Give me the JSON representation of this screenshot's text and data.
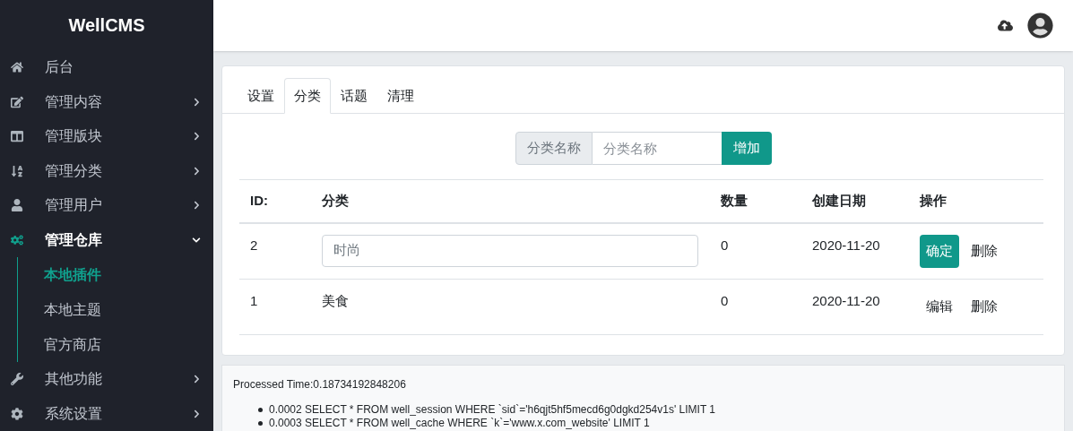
{
  "sidebar": {
    "logo": "WellCMS",
    "items": [
      {
        "label": "后台",
        "expanded": false
      },
      {
        "label": "管理内容",
        "expanded": false
      },
      {
        "label": "管理版块",
        "expanded": false
      },
      {
        "label": "管理分类",
        "expanded": false
      },
      {
        "label": "管理用户",
        "expanded": false
      },
      {
        "label": "管理仓库",
        "expanded": true,
        "children": [
          {
            "label": "本地插件",
            "selected": true
          },
          {
            "label": "本地主题",
            "selected": false
          },
          {
            "label": "官方商店",
            "selected": false
          }
        ]
      },
      {
        "label": "其他功能",
        "expanded": false
      },
      {
        "label": "系统设置",
        "expanded": false
      }
    ]
  },
  "tabs": [
    {
      "label": "设置",
      "selected": false
    },
    {
      "label": "分类",
      "selected": true
    },
    {
      "label": "话题",
      "selected": false
    },
    {
      "label": "清理",
      "selected": false
    }
  ],
  "add_form": {
    "addon": "分类名称",
    "placeholder": "分类名称",
    "button": "增加"
  },
  "table": {
    "columns": [
      "ID:",
      "分类",
      "数量",
      "创建日期",
      "操作"
    ],
    "rows": [
      {
        "kind": "editing",
        "id": "2",
        "name": "时尚",
        "count": "0",
        "date": "2020-11-20",
        "actions": [
          "确定",
          "删除"
        ]
      },
      {
        "kind": "view",
        "id": "1",
        "name": "美食",
        "count": "0",
        "date": "2020-11-20",
        "actions": [
          "编辑",
          "删除"
        ]
      }
    ]
  },
  "debug": {
    "time": "Processed Time:0.18734192848206",
    "queries": [
      "0.0002 SELECT * FROM well_session WHERE `sid`='h6qjt5hf5mecd6g0dgkd254v1s' LIMIT 1",
      "0.0003 SELECT * FROM well_cache WHERE `k`='www.x.com_website' LIMIT 1"
    ]
  }
}
